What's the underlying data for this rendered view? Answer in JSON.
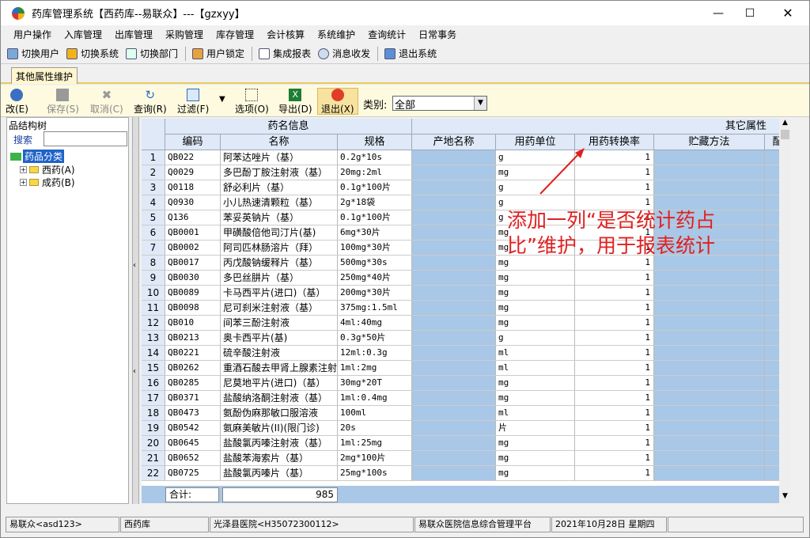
{
  "window": {
    "title": "药库管理系统【西药库--易联众】---【gzxyy】"
  },
  "menu": [
    "用户操作",
    "入库管理",
    "出库管理",
    "采购管理",
    "库存管理",
    "会计核算",
    "系统维护",
    "查询统计",
    "日常事务"
  ],
  "toolbar": [
    "切换用户",
    "切换系统",
    "切换部门",
    "用户锁定",
    "集成报表",
    "消息收发",
    "退出系统"
  ],
  "tab": "其他属性维护",
  "ftoolbar": {
    "edit": "改(E)",
    "save": "保存(S)",
    "cancel": "取消(C)",
    "query": "查询(R)",
    "filter": "过滤(F)",
    "options": "选项(O)",
    "export": "导出(D)",
    "exit": "退出(X)",
    "type_label": "类别:",
    "type_value": "全部"
  },
  "tree": {
    "title": "品结构树",
    "search_label": "搜索",
    "root": "药品分类",
    "children": [
      "西药(A)",
      "成药(B)"
    ]
  },
  "grid": {
    "group1": "药名信息",
    "group2": "其它属性",
    "columns": [
      "编码",
      "名称",
      "规格",
      "产地名称",
      "用药单位",
      "用药转换率",
      "贮藏方法",
      "配"
    ],
    "rows": [
      [
        "1",
        "QB022",
        "阿苯达唑片（基）",
        "0.2g*10s",
        "",
        "g",
        "1"
      ],
      [
        "2",
        "Q0029",
        "多巴酚丁胺注射液（基）",
        "20mg:2ml",
        "",
        "mg",
        "1"
      ],
      [
        "3",
        "Q0118",
        "舒必利片（基）",
        "0.1g*100片",
        "",
        "g",
        "1"
      ],
      [
        "4",
        "Q0930",
        "小儿热速清颗粒（基）",
        "2g*18袋",
        "",
        "g",
        "1"
      ],
      [
        "5",
        "Q136",
        "苯妥英钠片（基）",
        "0.1g*100片",
        "",
        "g",
        "1"
      ],
      [
        "6",
        "QB0001",
        "甲磺酸倍他司汀片(基)",
        "6mg*30片",
        "",
        "mg",
        "1"
      ],
      [
        "7",
        "QB0002",
        "阿司匹林肠溶片（拜）",
        "100mg*30片",
        "",
        "mg",
        "1"
      ],
      [
        "8",
        "QB0017",
        "丙戊酸钠缓释片（基）",
        "500mg*30s",
        "",
        "mg",
        "1"
      ],
      [
        "9",
        "QB0030",
        "多巴丝肼片（基）",
        "250mg*40片",
        "",
        "mg",
        "1"
      ],
      [
        "10",
        "QB0089",
        "卡马西平片(进口)（基）",
        "200mg*30片",
        "",
        "mg",
        "1"
      ],
      [
        "11",
        "QB0098",
        "尼可刹米注射液（基）",
        "375mg:1.5ml",
        "",
        "mg",
        "1"
      ],
      [
        "12",
        "QB010",
        "间苯三酚注射液",
        "4ml:40mg",
        "",
        "mg",
        "1"
      ],
      [
        "13",
        "QB0213",
        "奥卡西平片(基)",
        "0.3g*50片",
        "",
        "g",
        "1"
      ],
      [
        "14",
        "QB0221",
        "硫辛酸注射液",
        "12ml:0.3g",
        "",
        "ml",
        "1"
      ],
      [
        "15",
        "QB0262",
        "重酒石酸去甲肾上腺素注射液",
        "1ml:2mg",
        "",
        "ml",
        "1"
      ],
      [
        "16",
        "QB0285",
        "尼莫地平片(进口)（基）",
        "30mg*20T",
        "",
        "mg",
        "1"
      ],
      [
        "17",
        "QB0371",
        "盐酸纳洛酮注射液（基）",
        "1ml:0.4mg",
        "",
        "mg",
        "1"
      ],
      [
        "18",
        "QB0473",
        "氨酚伪麻那敏口服溶液",
        "100ml",
        "",
        "ml",
        "1"
      ],
      [
        "19",
        "QB0542",
        "氨麻美敏片(II)(限门诊)",
        "20s",
        "",
        "片",
        "1"
      ],
      [
        "20",
        "QB0645",
        "盐酸氯丙嗪注射液（基）",
        "1ml:25mg",
        "",
        "mg",
        "1"
      ],
      [
        "21",
        "QB0652",
        "盐酸苯海索片（基）",
        "2mg*100片",
        "",
        "mg",
        "1"
      ],
      [
        "22",
        "QB0725",
        "盐酸氯丙嗪片（基）",
        "25mg*100s",
        "",
        "mg",
        "1"
      ]
    ],
    "total_label": "合计:",
    "total_value": "985"
  },
  "annotation": "添加一列“是否统计药占比”维护，用于报表统计",
  "status": [
    "易联众<asd123>",
    "西药库",
    "光泽县医院<H35072300112>",
    "易联众医院信息综合管理平台",
    "2021年10月28日 星期四"
  ],
  "colors": {
    "annotation": "#e02020",
    "blue_col": "#a9c7e6",
    "header": "#dfe9f7"
  }
}
